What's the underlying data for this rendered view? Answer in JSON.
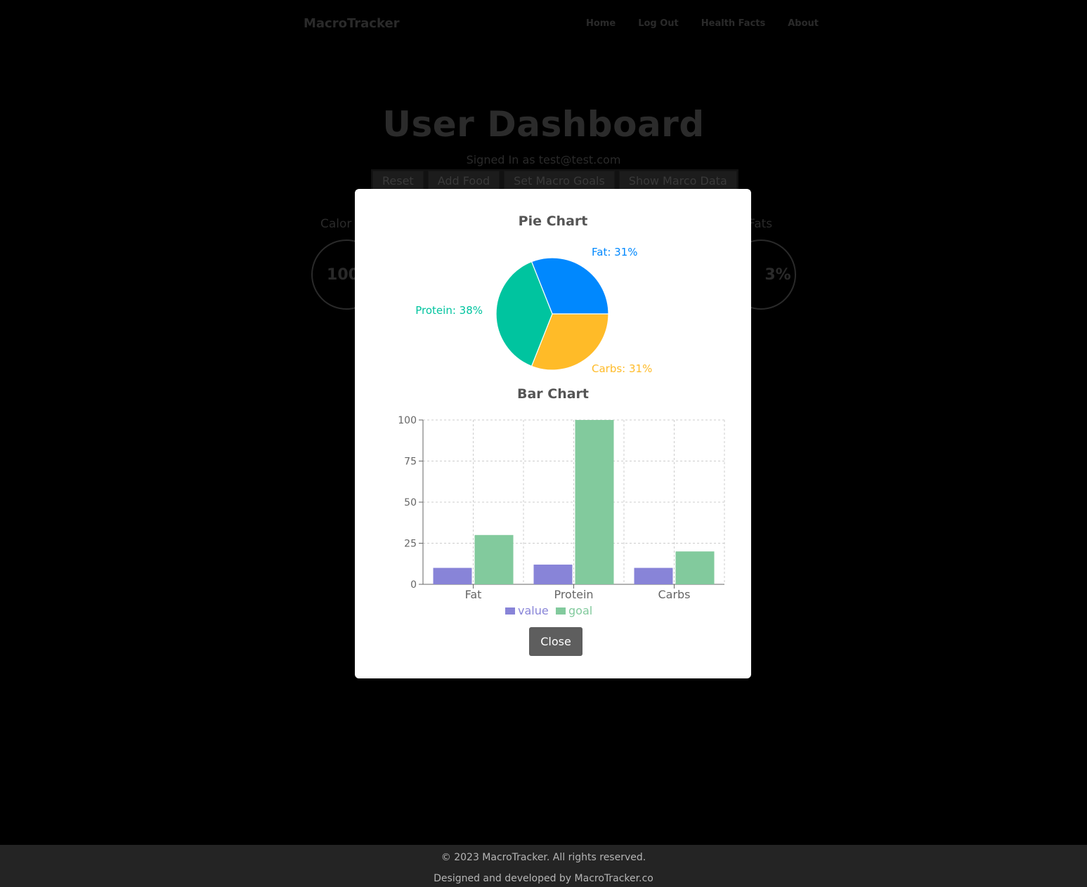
{
  "nav": {
    "brand": "MacroTracker",
    "links": [
      "Home",
      "Log Out",
      "Health Facts",
      "About"
    ]
  },
  "dashboard": {
    "title": "User Dashboard",
    "signed_in": "Signed In as test@test.com",
    "buttons": [
      "Reset",
      "Add Food",
      "Set Macro Goals",
      "Show Marco Data"
    ],
    "stats": [
      {
        "label": "Calor",
        "value": "100"
      },
      {
        "label": "Fats",
        "value": "3%"
      }
    ]
  },
  "modal": {
    "pie_title": "Pie Chart",
    "bar_title": "Bar Chart",
    "close_label": "Close"
  },
  "chart_data": [
    {
      "type": "pie",
      "title": "Pie Chart",
      "slices": [
        {
          "label": "Fat: 31%",
          "name": "Fat",
          "value": 31,
          "color": "#0088FE"
        },
        {
          "label": "Carbs: 31%",
          "name": "Carbs",
          "value": 31,
          "color": "#FFBB28"
        },
        {
          "label": "Protein: 38%",
          "name": "Protein",
          "value": 38,
          "color": "#00C49F"
        }
      ]
    },
    {
      "type": "bar",
      "title": "Bar Chart",
      "categories": [
        "Fat",
        "Protein",
        "Carbs"
      ],
      "series": [
        {
          "name": "value",
          "values": [
            10,
            12,
            10
          ],
          "color": "#8884d8"
        },
        {
          "name": "goal",
          "values": [
            30,
            100,
            20
          ],
          "color": "#82ca9d"
        }
      ],
      "ylim": [
        0,
        100
      ],
      "yticks": [
        0,
        25,
        50,
        75,
        100
      ],
      "grid": true,
      "legend": "bottom"
    }
  ],
  "footer": {
    "copyright": "© 2023 MacroTracker. All rights reserved.",
    "credit": "Designed and developed by MacroTracker.co"
  }
}
